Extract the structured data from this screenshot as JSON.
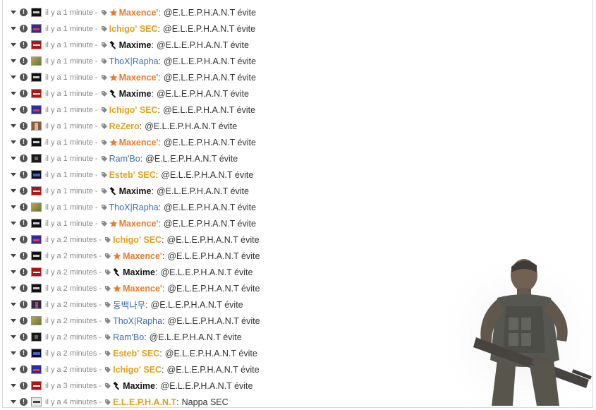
{
  "messages": [
    {
      "time": "il y a 1 minute -",
      "user": "Maxence'",
      "role": "orange",
      "badge": "star",
      "avatar": "mx",
      "message": "@E.L.E.P.H.A.N.T évite"
    },
    {
      "time": "il y a 1 minute -",
      "user": "Ichigo' SEC",
      "role": "gold",
      "badge": "",
      "avatar": "ichigo",
      "message": "@E.L.E.P.H.A.N.T évite"
    },
    {
      "time": "il y a 1 minute -",
      "user": "Maxime",
      "role": "black",
      "badge": "hammer",
      "avatar": "maxime",
      "message": "@E.L.E.P.H.A.N.T évite"
    },
    {
      "time": "il y a 1 minute -",
      "user": "ThoX|Rapha",
      "role": "blue",
      "badge": "",
      "avatar": "thox",
      "message": "@E.L.E.P.H.A.N.T évite"
    },
    {
      "time": "il y a 1 minute -",
      "user": "Maxence'",
      "role": "orange",
      "badge": "star",
      "avatar": "mx",
      "message": "@E.L.E.P.H.A.N.T évite"
    },
    {
      "time": "il y a 1 minute -",
      "user": "Maxime",
      "role": "black",
      "badge": "hammer",
      "avatar": "maxime",
      "message": "@E.L.E.P.H.A.N.T évite"
    },
    {
      "time": "il y a 1 minute -",
      "user": "Ichigo' SEC",
      "role": "gold",
      "badge": "",
      "avatar": "ichigo",
      "message": "@E.L.E.P.H.A.N.T évite"
    },
    {
      "time": "il y a 1 minute -",
      "user": "ReZero",
      "role": "gold",
      "badge": "",
      "avatar": "rezero",
      "message": "@E.L.E.P.H.A.N.T évite"
    },
    {
      "time": "il y a 1 minute -",
      "user": "Maxence'",
      "role": "orange",
      "badge": "star",
      "avatar": "mx",
      "message": "@E.L.E.P.H.A.N.T évite"
    },
    {
      "time": "il y a 1 minute -",
      "user": "Ram'Bo",
      "role": "blue",
      "badge": "",
      "avatar": "rambo",
      "message": "@E.L.E.P.H.A.N.T évite"
    },
    {
      "time": "il y a 1 minute -",
      "user": "Esteb' SEC",
      "role": "gold",
      "badge": "",
      "avatar": "esteb",
      "message": "@E.L.E.P.H.A.N.T évite"
    },
    {
      "time": "il y a 1 minute -",
      "user": "Maxime",
      "role": "black",
      "badge": "hammer",
      "avatar": "maxime",
      "message": "@E.L.E.P.H.A.N.T évite"
    },
    {
      "time": "il y a 1 minute -",
      "user": "ThoX|Rapha",
      "role": "blue",
      "badge": "",
      "avatar": "thox",
      "message": "@E.L.E.P.H.A.N.T évite"
    },
    {
      "time": "il y a 1 minute -",
      "user": "Maxence'",
      "role": "orange",
      "badge": "star",
      "avatar": "mx",
      "message": "@E.L.E.P.H.A.N.T évite"
    },
    {
      "time": "il y a 2 minutes -",
      "user": "Ichigo' SEC",
      "role": "gold",
      "badge": "",
      "avatar": "ichigo",
      "message": "@E.L.E.P.H.A.N.T évite"
    },
    {
      "time": "il y a 2 minutes -",
      "user": "Maxence'",
      "role": "orange",
      "badge": "star",
      "avatar": "mx",
      "message": "@E.L.E.P.H.A.N.T évite"
    },
    {
      "time": "il y a 2 minutes -",
      "user": "Maxime",
      "role": "black",
      "badge": "hammer",
      "avatar": "maxime",
      "message": "@E.L.E.P.H.A.N.T évite"
    },
    {
      "time": "il y a 2 minutes -",
      "user": "Maxence'",
      "role": "orange",
      "badge": "star",
      "avatar": "mx",
      "message": "@E.L.E.P.H.A.N.T évite"
    },
    {
      "time": "il y a 2 minutes -",
      "user": "동백나무",
      "role": "blue",
      "badge": "",
      "avatar": "dong",
      "message": "@E.L.E.P.H.A.N.T évite"
    },
    {
      "time": "il y a 2 minutes -",
      "user": "ThoX|Rapha",
      "role": "blue",
      "badge": "",
      "avatar": "thox",
      "message": "@E.L.E.P.H.A.N.T évite"
    },
    {
      "time": "il y a 2 minutes -",
      "user": "Ram'Bo",
      "role": "blue",
      "badge": "",
      "avatar": "rambo",
      "message": "@E.L.E.P.H.A.N.T évite"
    },
    {
      "time": "il y a 2 minutes -",
      "user": "Esteb' SEC",
      "role": "gold",
      "badge": "",
      "avatar": "esteb",
      "message": "@E.L.E.P.H.A.N.T évite"
    },
    {
      "time": "il y a 2 minutes -",
      "user": "Ichigo' SEC",
      "role": "gold",
      "badge": "",
      "avatar": "ichigo",
      "message": "@E.L.E.P.H.A.N.T évite"
    },
    {
      "time": "il y a 3 minutes -",
      "user": "Maxime",
      "role": "black",
      "badge": "hammer",
      "avatar": "maxime",
      "message": "@E.L.E.P.H.A.N.T évite"
    },
    {
      "time": "il y a 4 minutes -",
      "user": "E.L.E.P.H.A.N.T",
      "role": "gold",
      "badge": "",
      "avatar": "elephant",
      "message": "Nappa SEC"
    }
  ],
  "colors": {
    "orange": "#ea7a2a",
    "gold": "#e2a01a",
    "black": "#111111",
    "blue": "#3b6ea5",
    "timestamp": "#888888"
  },
  "icons": {
    "collapse": "caret-down-icon",
    "report": "exclamation-circle-icon",
    "tag": "tag-icon",
    "star": "star-icon",
    "hammer": "hammer-icon"
  }
}
